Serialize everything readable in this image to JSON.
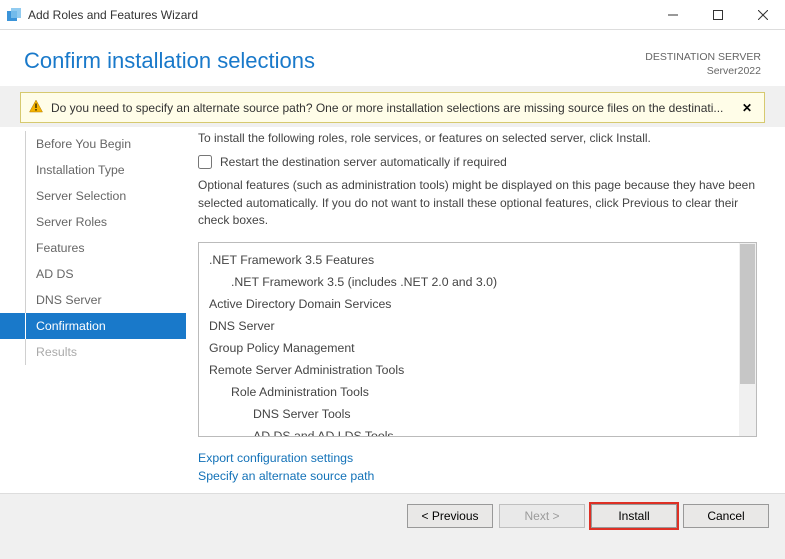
{
  "window": {
    "title": "Add Roles and Features Wizard"
  },
  "header": {
    "title": "Confirm installation selections",
    "dest_label": "DESTINATION SERVER",
    "dest_server": "Server2022"
  },
  "alert": {
    "text": "Do you need to specify an alternate source path? One or more installation selections are missing source files on the destinati..."
  },
  "sidebar": {
    "steps": [
      {
        "label": "Before You Begin",
        "state": "normal"
      },
      {
        "label": "Installation Type",
        "state": "normal"
      },
      {
        "label": "Server Selection",
        "state": "normal"
      },
      {
        "label": "Server Roles",
        "state": "normal"
      },
      {
        "label": "Features",
        "state": "normal"
      },
      {
        "label": "AD DS",
        "state": "normal"
      },
      {
        "label": "DNS Server",
        "state": "normal"
      },
      {
        "label": "Confirmation",
        "state": "active"
      },
      {
        "label": "Results",
        "state": "disabled"
      }
    ]
  },
  "main": {
    "intro": "To install the following roles, role services, or features on selected server, click Install.",
    "restart_label": "Restart the destination server automatically if required",
    "opt_desc": "Optional features (such as administration tools) might be displayed on this page because they have been selected automatically. If you do not want to install these optional features, click Previous to clear their check boxes.",
    "features": [
      {
        "text": ".NET Framework 3.5 Features",
        "indent": 0
      },
      {
        "text": ".NET Framework 3.5 (includes .NET 2.0 and 3.0)",
        "indent": 1
      },
      {
        "text": "Active Directory Domain Services",
        "indent": 0
      },
      {
        "text": "DNS Server",
        "indent": 0
      },
      {
        "text": "Group Policy Management",
        "indent": 0
      },
      {
        "text": "Remote Server Administration Tools",
        "indent": 0
      },
      {
        "text": "Role Administration Tools",
        "indent": 1
      },
      {
        "text": "DNS Server Tools",
        "indent": 2
      },
      {
        "text": "AD DS and AD LDS Tools",
        "indent": 2
      }
    ],
    "link_export": "Export configuration settings",
    "link_source": "Specify an alternate source path"
  },
  "footer": {
    "previous": "< Previous",
    "next": "Next >",
    "install": "Install",
    "cancel": "Cancel"
  }
}
